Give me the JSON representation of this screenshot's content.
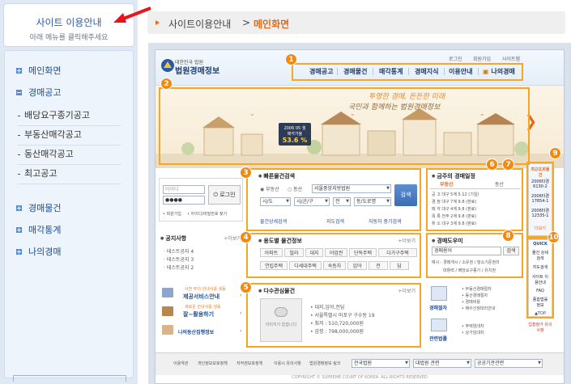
{
  "sidebar": {
    "title": "사이트 이용안내",
    "subtitle": "아래 메뉴를 클릭해주세요",
    "menu": [
      {
        "label": "메인화면",
        "state": "plus"
      },
      {
        "label": "경매공고",
        "state": "minus"
      },
      {
        "label": "경매물건",
        "state": "plus"
      },
      {
        "label": "매각통계",
        "state": "plus"
      },
      {
        "label": "나의경매",
        "state": "plus"
      }
    ],
    "submenu": [
      "배당요구종기공고",
      "부동산매각공고",
      "동산매각공고",
      "최고공고"
    ]
  },
  "breadcrumb": {
    "parent": "사이트이용안내",
    "separator": ">",
    "current": "메인화면"
  },
  "site": {
    "logo_small": "대한민국 법원",
    "logo_big": "법원경매정보",
    "util_links": [
      "로그인",
      "회원가입",
      "사이트맵"
    ],
    "gnb": [
      "경매공고",
      "경매물건",
      "매각통계",
      "경매지식",
      "이용안내",
      "나의경매"
    ],
    "banner": {
      "slogan1": "투명한 경매, 든든한 미래",
      "slogan2": "국민과 함께하는 법원경매정보",
      "stat_line1": "2006 05 월",
      "stat_line2": "매각가율",
      "stat_value": "53.6 %"
    },
    "login": {
      "id_placeholder": "아이디",
      "pw_value": "●●●●",
      "button": "로그인",
      "links": [
        "회원가입",
        "아이디/비밀번호 찾기"
      ]
    },
    "quick_search": {
      "title": "빠른물건검색",
      "radio": [
        "부동산",
        "동산"
      ],
      "court": "서울중앙지방법원",
      "sido": "시/도",
      "sigungu": "시/군/구",
      "jeon": "전",
      "dong": "동/도로명",
      "search_btn": "검색",
      "links": [
        "물건상세검색",
        "지도검색",
        "자동차 중기검색"
      ]
    },
    "notice": {
      "title": "공지사항",
      "more": "+더보기",
      "items": [
        "테스트공지 4",
        "테스트공지 3",
        "테스트공지 2"
      ]
    },
    "purpose_search": {
      "title": "용도별 물건정보",
      "more": "+더보기",
      "row1": [
        "아파트",
        "빌라",
        "대지",
        "어업권",
        "단독주택",
        "다가구주택"
      ],
      "row2": [
        "연립주택",
        "다세대주택",
        "숙동차",
        "임야",
        "전",
        "답"
      ]
    },
    "promo": [
      {
        "line": "사전 주의 안내서를 생동",
        "label": "제공서비스안내"
      },
      {
        "line": "새로운 안내서를 생동",
        "label": "잘~활용하기"
      },
      {
        "label": "나의동산집행정보"
      }
    ],
    "interest": {
      "title": "다수관심물건",
      "more": "+더보기",
      "no_image": "이미지가 없습니다",
      "details": [
        "• 대지,임야,전답",
        "• 서울특별시 마포구 구수동 19",
        "• 최저 : 510,720,000원",
        "• 감정 : 798,000,000원"
      ]
    },
    "schedule": {
      "title": "금주의 경매일정",
      "tabs": [
        "부동산",
        "동산"
      ],
      "rows": [
        {
          "k": "공 고",
          "v": "대구 5계 5.12 (기일)"
        },
        {
          "k": "경 정",
          "v": "대구 7계 9.8 (판료)"
        },
        {
          "k": "매 각",
          "v": "대구 4계 9.8 (판료)"
        },
        {
          "k": "목 록",
          "v": "전주 2계 9.8 (판료)"
        },
        {
          "k": "취 소",
          "v": "대구 3계 9.8 (판료)"
        }
      ]
    },
    "glossary": {
      "title": "경매도우미",
      "input": "경매용어",
      "btn": "검색",
      "terms1": "예시 : 경매개시 / 소유권 / 말소기준권리",
      "terms2": "대항력 / 배당요구종기 / 유치권"
    },
    "procedures": [
      {
        "label": "경매절차",
        "items": [
          "• 부동산경매절차",
          "• 동산경매절차",
          "• 경매비용",
          "• 배수신청대리안내"
        ]
      },
      {
        "label": "관련법률",
        "items": [
          "• 주택임대차",
          "• 상가임대차"
        ]
      }
    ],
    "latest": {
      "title": "최근조회물건",
      "items": [
        "2006타경 6130-2",
        "2006타경 17854-1",
        "2006타경 12335-1"
      ],
      "more": "더보기"
    },
    "quick": {
      "title": "QUICK",
      "items": [
        "물건 상세검색",
        "지도검색",
        "사이트 이용안내",
        "FAQ",
        "종합법률 정보"
      ],
      "top": "▲TOP",
      "notice": "입찰참가 유의사항"
    },
    "footer": {
      "links": [
        "이용약관",
        "개인정보보호정책",
        "저작권보호정책",
        "이용시 유의사항",
        "법원경매정보 링크"
      ],
      "selects": [
        "전국법원",
        "대법원 관련",
        "공공기관관련"
      ],
      "copyright": "COPYRIGHT © SUPREME COURT OF KOREA. ALL RIGHTS RESERVED"
    }
  },
  "badges": [
    "1",
    "2",
    "3",
    "4",
    "5",
    "6",
    "7",
    "8",
    "9",
    "10"
  ],
  "colors": {
    "accent": "#f08a12",
    "brand": "#1f4e94",
    "highlight": "#f5a623",
    "pointer": "#e8131b"
  }
}
